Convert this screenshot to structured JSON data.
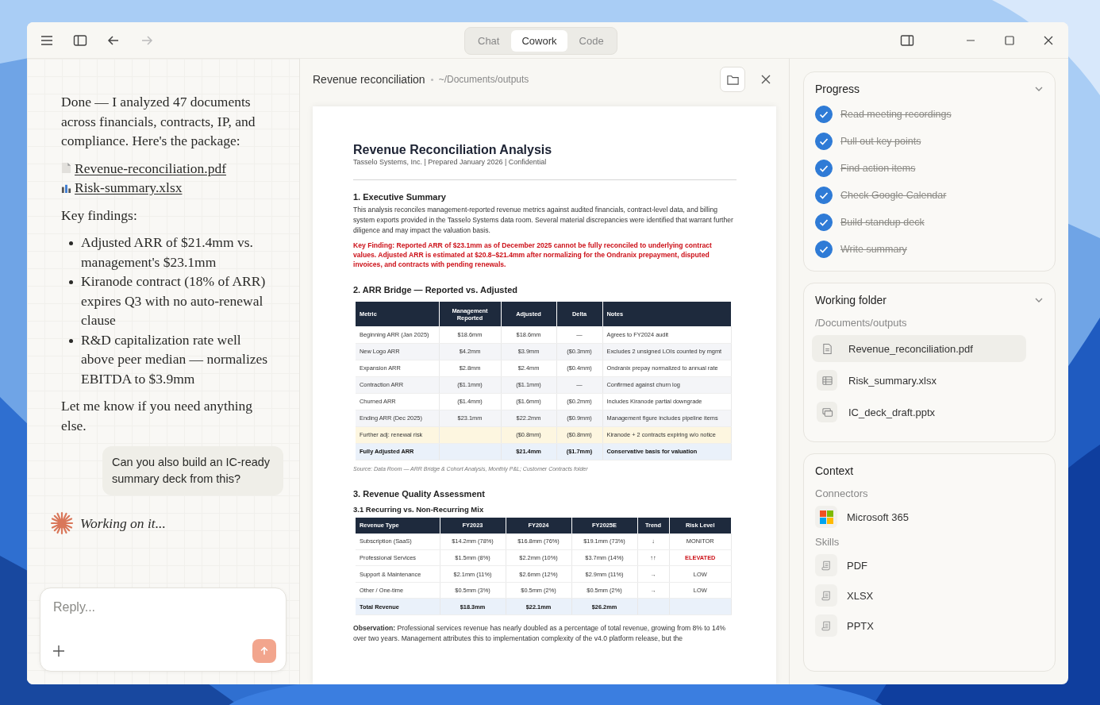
{
  "window": {
    "tabs": [
      {
        "label": "Chat",
        "selected": false
      },
      {
        "label": "Cowork",
        "selected": true
      },
      {
        "label": "Code",
        "selected": false
      }
    ]
  },
  "chat": {
    "intro": "Done — I analyzed 47 documents across financials, contracts, IP, and compliance. Here's the package:",
    "attachments": [
      {
        "kind": "pdf",
        "name": "Revenue-reconciliation.pdf"
      },
      {
        "kind": "sheet",
        "name": "Risk-summary.xlsx"
      }
    ],
    "findings_heading": "Key findings:",
    "findings": [
      "Adjusted ARR of $21.4mm vs. management's $23.1mm",
      "Kiranode contract (18% of ARR) expires Q3 with no auto-renewal clause",
      "R&D capitalization rate well above peer median — normalizes EBITDA to $3.9mm"
    ],
    "closing": "Let me know if you need anything else.",
    "user_message": "Can you also build an IC-ready summary deck from this?",
    "status": "Working on it...",
    "reply": {
      "placeholder": "Reply..."
    }
  },
  "document": {
    "title": "Revenue reconciliation",
    "path": "~/Documents/outputs",
    "page": {
      "title": "Revenue Reconciliation Analysis",
      "subtitle": "Tasselo Systems, Inc. | Prepared January 2026 | Confidential",
      "heading_1": "1. Executive Summary",
      "summary": "This analysis reconciles management-reported revenue metrics against audited financials, contract-level data, and billing system exports provided in the Tasselo Systems data room. Several material discrepancies were identified that warrant further diligence and may impact the valuation basis.",
      "key_finding": "Key Finding: Reported ARR of $23.1mm as of December 2025 cannot be fully reconciled to underlying contract values. Adjusted ARR is estimated at $20.8–$21.4mm after normalizing for the Ondranix prepayment, disputed invoices, and contracts with pending renewals.",
      "heading_2": "2. ARR Bridge — Reported vs. Adjusted",
      "arr_table": {
        "columns": [
          "Metric",
          "Management Reported",
          "Adjusted",
          "Delta",
          "Notes"
        ],
        "rows": [
          {
            "kind": "normal",
            "metric": "Beginning ARR (Jan 2025)",
            "reported": "$18.6mm",
            "adjusted": "$18.6mm",
            "delta": "—",
            "notes": "Agrees to FY2024 audit"
          },
          {
            "kind": "normal",
            "metric": "New Logo ARR",
            "reported": "$4.2mm",
            "adjusted": "$3.9mm",
            "delta": "($0.3mm)",
            "notes": "Excludes 2 unsigned LOIs counted by mgmt"
          },
          {
            "kind": "normal",
            "metric": "Expansion ARR",
            "reported": "$2.8mm",
            "adjusted": "$2.4mm",
            "delta": "($0.4mm)",
            "notes": "Ondranix prepay normalized to annual rate"
          },
          {
            "kind": "normal",
            "metric": "Contraction ARR",
            "reported": "($1.1mm)",
            "adjusted": "($1.1mm)",
            "delta": "—",
            "notes": "Confirmed against churn log"
          },
          {
            "kind": "normal",
            "metric": "Churned ARR",
            "reported": "($1.4mm)",
            "adjusted": "($1.6mm)",
            "delta": "($0.2mm)",
            "notes": "Includes Kiranode partial downgrade"
          },
          {
            "kind": "normal",
            "metric": "Ending ARR (Dec 2025)",
            "reported": "$23.1mm",
            "adjusted": "$22.2mm",
            "delta": "($0.9mm)",
            "notes": "Management figure includes pipeline items"
          },
          {
            "kind": "risk",
            "metric": "Further adj: renewal risk",
            "adjusted": "($0.8mm)",
            "delta": "($0.8mm)",
            "notes": "Kiranode + 2 contracts expiring w/o notice"
          },
          {
            "kind": "total",
            "metric": "Fully Adjusted ARR",
            "adjusted": "$21.4mm",
            "delta": "($1.7mm)",
            "notes": "Conservative basis for valuation"
          }
        ]
      },
      "arr_source": "Source: Data Room — ARR Bridge & Cohort Analysis, Monthly P&L; Customer Contracts folder",
      "heading_3": "3. Revenue Quality Assessment",
      "subheading": "3.1 Recurring vs. Non-Recurring Mix",
      "mix_table": {
        "columns": [
          "Revenue Type",
          "FY2023",
          "FY2024",
          "FY2025E",
          "Trend",
          "Risk Level"
        ],
        "rows": [
          {
            "kind": "normal",
            "type": "Subscription (SaaS)",
            "fy2023": "$14.2mm (78%)",
            "fy2024": "$16.8mm (76%)",
            "fy2025e": "$19.1mm (73%)",
            "trend": "↓",
            "risk": "MONITOR",
            "risk_alert": false
          },
          {
            "kind": "normal",
            "type": "Professional Services",
            "fy2023": "$1.5mm (8%)",
            "fy2024": "$2.2mm (10%)",
            "fy2025e": "$3.7mm (14%)",
            "trend": "↑↑",
            "risk": "ELEVATED",
            "risk_alert": true
          },
          {
            "kind": "normal",
            "type": "Support & Maintenance",
            "fy2023": "$2.1mm (11%)",
            "fy2024": "$2.6mm (12%)",
            "fy2025e": "$2.9mm (11%)",
            "trend": "→",
            "risk": "LOW",
            "risk_alert": false
          },
          {
            "kind": "normal",
            "type": "Other / One-time",
            "fy2023": "$0.5mm (3%)",
            "fy2024": "$0.5mm (2%)",
            "fy2025e": "$0.5mm (2%)",
            "trend": "→",
            "risk": "LOW",
            "risk_alert": false
          },
          {
            "kind": "total",
            "type": "Total Revenue",
            "fy2023": "$18.3mm",
            "fy2024": "$22.1mm",
            "fy2025e": "$26.2mm"
          }
        ]
      },
      "observation": "**Observation:** Professional services revenue has nearly doubled as a percentage of total revenue, growing from 8% to 14% over two years. Management attributes this to implementation complexity of the v4.0 platform release, but the"
    }
  },
  "progress": {
    "title": "Progress",
    "expanded": true,
    "steps": [
      {
        "label": "Read meeting recordings",
        "done": true
      },
      {
        "label": "Pull out key points",
        "done": true
      },
      {
        "label": "Find action items",
        "done": true
      },
      {
        "label": "Check Google Calendar",
        "done": true
      },
      {
        "label": "Build standup deck",
        "done": true
      },
      {
        "label": "Write summary",
        "done": true
      }
    ]
  },
  "working_folder": {
    "title": "Working folder",
    "expanded": true,
    "path": "/Documents/outputs",
    "files": [
      {
        "name": "Revenue_reconciliation.pdf",
        "kind": "doc",
        "selected": true
      },
      {
        "name": "Risk_summary.xlsx",
        "kind": "sheet",
        "selected": false
      },
      {
        "name": "IC_deck_draft.pptx",
        "kind": "slides",
        "selected": false
      }
    ]
  },
  "context": {
    "title": "Context",
    "connectors_label": "Connectors",
    "connectors": [
      {
        "name": "Microsoft 365"
      }
    ],
    "skills_label": "Skills",
    "skills": [
      {
        "name": "PDF"
      },
      {
        "name": "XLSX"
      },
      {
        "name": "PPTX"
      }
    ]
  }
}
